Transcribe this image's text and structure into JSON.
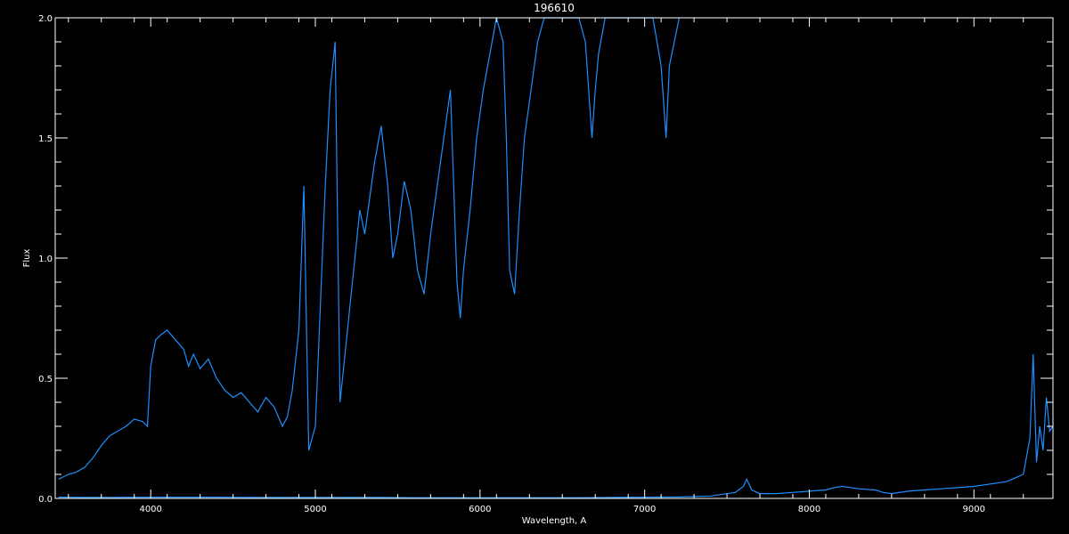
{
  "chart_data": {
    "type": "line",
    "title": "196610",
    "xlabel": "Wavelength, A",
    "ylabel": "Flux",
    "xlim": [
      3420,
      9480
    ],
    "ylim": [
      0.0,
      2.0
    ],
    "x_ticks": [
      4000,
      5000,
      6000,
      7000,
      8000,
      9000
    ],
    "x_tick_labels": [
      "4000",
      "5000",
      "6000",
      "7000",
      "8000",
      "9000"
    ],
    "y_ticks": [
      0.0,
      0.5,
      1.0,
      1.5,
      2.0
    ],
    "y_tick_labels": [
      "0.0",
      "0.5",
      "1.0",
      "1.5",
      "2.0"
    ],
    "grid": false,
    "background": "#000000",
    "axis_color": "#ffffff",
    "series": [
      {
        "color": "#1e8fff",
        "x": [
          3440,
          3500,
          3550,
          3600,
          3650,
          3700,
          3750,
          3800,
          3850,
          3900,
          3950,
          3980,
          4000,
          4030,
          4060,
          4100,
          4150,
          4200,
          4230,
          4260,
          4300,
          4350,
          4400,
          4450,
          4500,
          4550,
          4600,
          4650,
          4700,
          4750,
          4800,
          4830,
          4860,
          4900,
          4930,
          4960,
          4980,
          5000,
          5030,
          5060,
          5090,
          5120,
          5150,
          5180,
          5210,
          5240,
          5270,
          5300,
          5330,
          5360,
          5400,
          5440,
          5470,
          5500,
          5540,
          5580,
          5620,
          5660,
          5700,
          5740,
          5780,
          5820,
          5860,
          5880,
          5900,
          5940,
          5980,
          6020,
          6060,
          6100,
          6140,
          6160,
          6180,
          6210,
          6240,
          6270,
          6310,
          6350,
          6390,
          6430,
          6470,
          6510,
          6560,
          6600,
          6640,
          6680,
          6700,
          6720,
          6760,
          6800,
          6850,
          6900,
          6950,
          7000,
          7050,
          7100,
          7130,
          7150,
          7180,
          7210
        ],
        "y": [
          0.08,
          0.1,
          0.11,
          0.13,
          0.17,
          0.22,
          0.26,
          0.28,
          0.3,
          0.33,
          0.32,
          0.3,
          0.55,
          0.66,
          0.68,
          0.7,
          0.66,
          0.62,
          0.55,
          0.6,
          0.54,
          0.58,
          0.5,
          0.45,
          0.42,
          0.44,
          0.4,
          0.36,
          0.42,
          0.38,
          0.3,
          0.34,
          0.45,
          0.7,
          1.3,
          0.2,
          0.25,
          0.3,
          0.8,
          1.3,
          1.7,
          1.9,
          0.4,
          0.6,
          0.8,
          1.0,
          1.2,
          1.1,
          1.25,
          1.4,
          1.55,
          1.3,
          1.0,
          1.1,
          1.32,
          1.2,
          0.95,
          0.85,
          1.1,
          1.3,
          1.5,
          1.7,
          0.9,
          0.75,
          0.95,
          1.2,
          1.5,
          1.7,
          1.85,
          2.0,
          1.9,
          1.5,
          0.95,
          0.85,
          1.2,
          1.5,
          1.7,
          1.9,
          2.0,
          2.0,
          2.0,
          2.0,
          2.0,
          2.0,
          1.9,
          1.5,
          1.7,
          1.85,
          2.0,
          2.0,
          2.0,
          2.0,
          2.0,
          2.0,
          2.0,
          1.8,
          1.5,
          1.8,
          1.9,
          2.0
        ]
      },
      {
        "color": "#1e8fff",
        "x": [
          3440,
          3600,
          3800,
          4000,
          4200,
          4400,
          4600,
          4800,
          5000,
          5200,
          5400,
          5600,
          5800,
          6000,
          6200,
          6400,
          6600,
          6800,
          7000,
          7200,
          7400,
          7550,
          7600,
          7620,
          7650,
          7700,
          7800,
          7900,
          8000,
          8100,
          8150,
          8200,
          8300,
          8400,
          8450,
          8500,
          8600,
          8700,
          8800,
          8900,
          9000,
          9100,
          9200,
          9300,
          9340,
          9360,
          9380,
          9400,
          9420,
          9440,
          9460,
          9480
        ],
        "y": [
          0.005,
          0.004,
          0.004,
          0.005,
          0.005,
          0.005,
          0.004,
          0.004,
          0.004,
          0.004,
          0.004,
          0.003,
          0.003,
          0.003,
          0.003,
          0.003,
          0.003,
          0.004,
          0.005,
          0.006,
          0.01,
          0.025,
          0.05,
          0.08,
          0.035,
          0.02,
          0.02,
          0.025,
          0.03,
          0.035,
          0.045,
          0.05,
          0.04,
          0.035,
          0.025,
          0.02,
          0.03,
          0.035,
          0.04,
          0.045,
          0.05,
          0.06,
          0.07,
          0.1,
          0.25,
          0.6,
          0.15,
          0.3,
          0.2,
          0.42,
          0.28,
          0.3
        ]
      }
    ]
  }
}
